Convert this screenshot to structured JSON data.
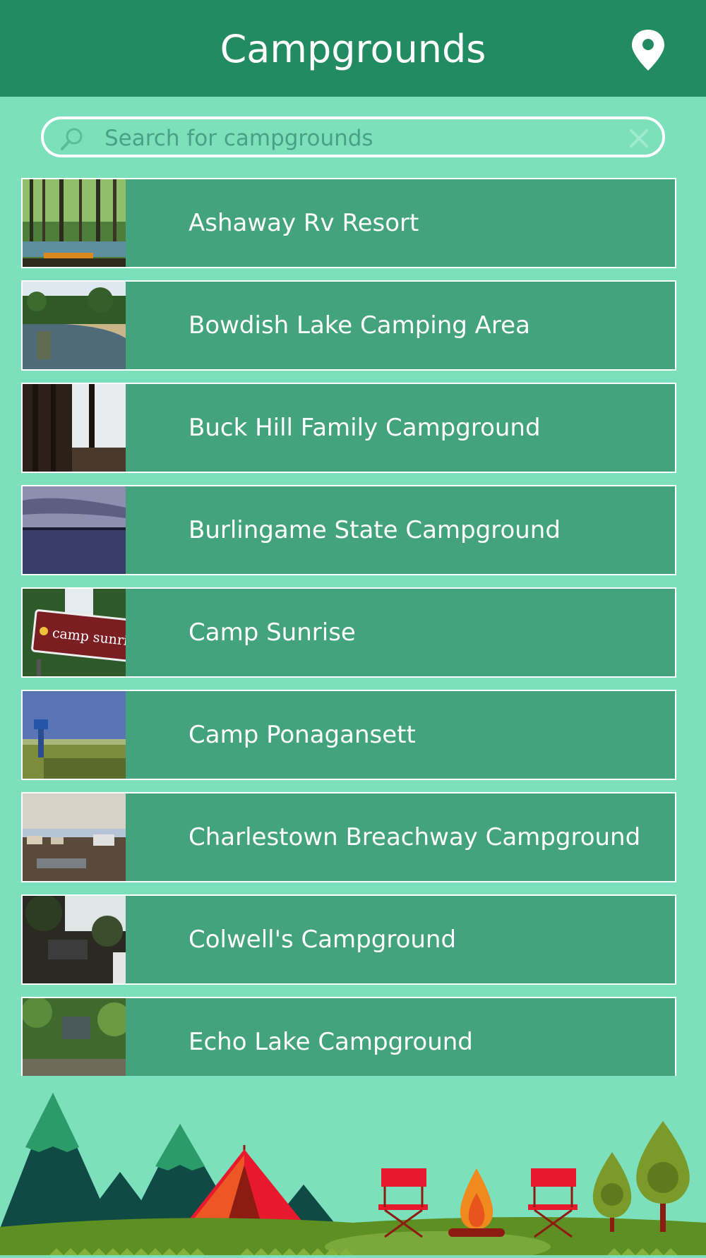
{
  "header": {
    "title": "Campgrounds",
    "location_icon": "map-pin-icon"
  },
  "search": {
    "placeholder": "Search for campgrounds",
    "value": "",
    "search_icon": "magnifier-icon",
    "clear_icon": "close-icon"
  },
  "campgrounds": [
    {
      "name": "Ashaway Rv Resort",
      "thumb": "forest-stream"
    },
    {
      "name": "Bowdish Lake Camping Area",
      "thumb": "lake-beach"
    },
    {
      "name": "Buck Hill Family Campground",
      "thumb": "trees-lake"
    },
    {
      "name": "Burlingame State Campground",
      "thumb": "dusk-lake"
    },
    {
      "name": "Camp Sunrise",
      "thumb": "camp-sunrise-sign"
    },
    {
      "name": "Camp Ponagansett",
      "thumb": "field-sign"
    },
    {
      "name": "Charlestown Breachway Campground",
      "thumb": "parking-lot"
    },
    {
      "name": "Colwell's Campground",
      "thumb": "wooded-sign"
    },
    {
      "name": "Echo Lake Campground",
      "thumb": "campsite-trees"
    }
  ],
  "thumb_text": {
    "camp_sunrise_sign": "camp sunrise"
  },
  "colors": {
    "header": "#238b62",
    "background": "#7ce0bc",
    "row": "#43a37c",
    "accent_red": "#e8192c"
  }
}
